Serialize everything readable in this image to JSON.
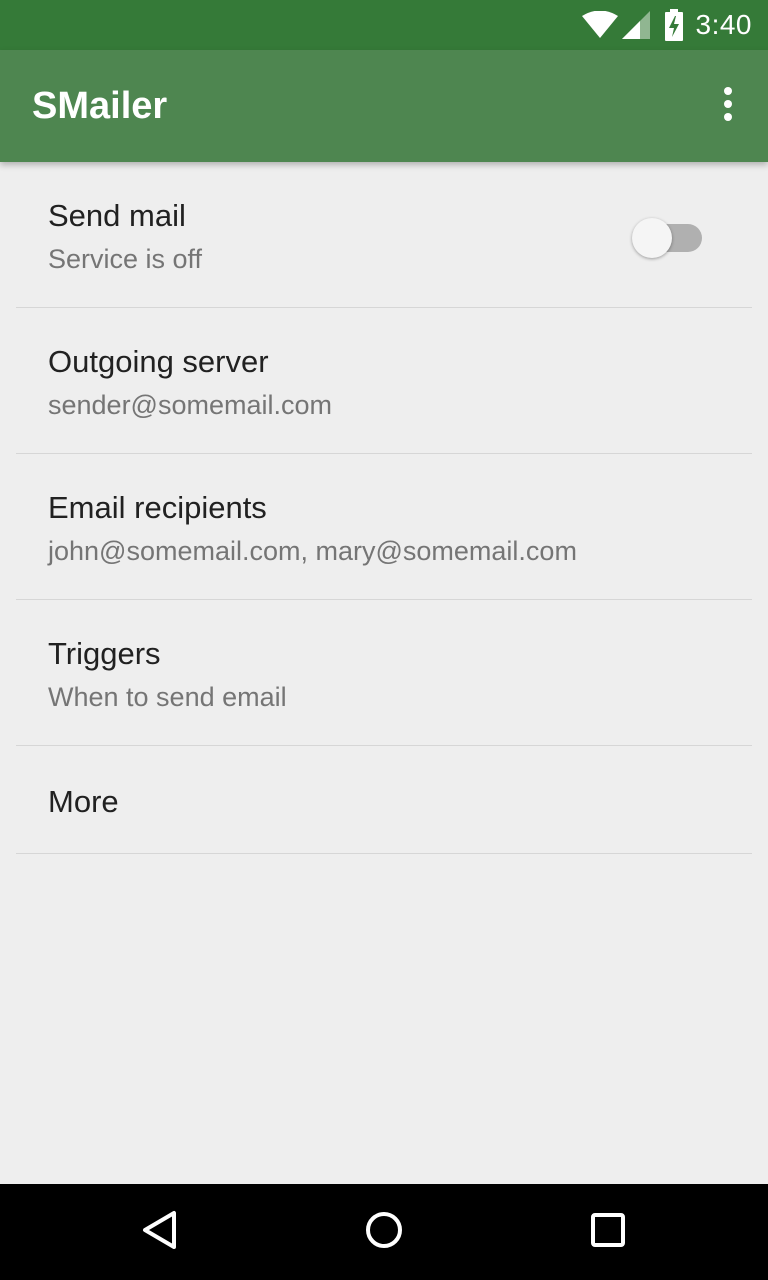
{
  "status_bar": {
    "time": "3:40",
    "icons": [
      "wifi-icon",
      "cell-signal-icon",
      "battery-charging-icon"
    ],
    "background": "#357a38"
  },
  "app_bar": {
    "title": "SMailer",
    "overflow_icon": "more-vert-icon",
    "background": "#4e8650"
  },
  "preferences": [
    {
      "title": "Send mail",
      "summary": "Service is off",
      "switch_on": false
    },
    {
      "title": "Outgoing server",
      "summary": "sender@somemail.com"
    },
    {
      "title": "Email recipients",
      "summary": "john@somemail.com, mary@somemail.com"
    },
    {
      "title": "Triggers",
      "summary": "When to send email"
    },
    {
      "title": "More"
    }
  ],
  "nav_bar": {
    "buttons": [
      "back-icon",
      "home-icon",
      "recents-icon"
    ]
  }
}
